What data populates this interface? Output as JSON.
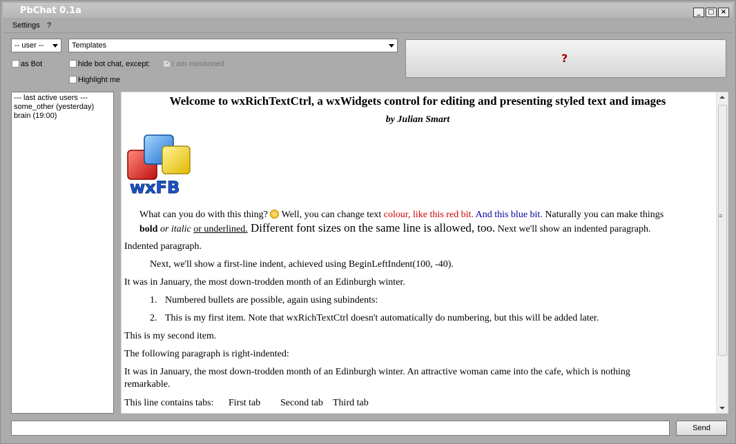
{
  "window": {
    "title": "PbChat 0.1a",
    "minimize": "_",
    "maximize": "□",
    "close": "×"
  },
  "menu": [
    {
      "label": "Settings"
    },
    {
      "label": "?"
    }
  ],
  "toolbar": {
    "user_select": "-- user --",
    "templates_select": "Templates",
    "as_bot": "as Bot",
    "hide_bot_chat": "hide bot chat, except:",
    "i_am_mentioned": "I am mentioned",
    "highlight_me": "Highlight me",
    "help_button": "?"
  },
  "users": {
    "header": "--- last active users ---",
    "items": [
      "some_other (yesterday)",
      "brain (19:00)"
    ]
  },
  "document": {
    "title": "Welcome to wxRichTextCtrl, a wxWidgets control for editing and presenting styled text and images",
    "byline": "by Julian Smart",
    "logo_text": "wxFB",
    "p1_a": "What can you do with this thing? ",
    "p1_b": " Well, you can change text ",
    "p1_red": "colour, like this red bit.",
    "p1_blue": " And this blue bit.",
    "p1_c": " Naturally you can make things",
    "p2_bold": "bold",
    "p2_italic": " or italic",
    "p2_underline": "or underlined.",
    "p2_big": " Different font sizes on the same line is allowed, too.",
    "p2_end": " Next we'll show an indented paragraph.",
    "indented": "Indented paragraph.",
    "first_line_indent": "Next, we'll show a first-line indent, achieved using BeginLeftIndent(100, -40).",
    "january1": "It was in January, the most down-trodden month of an Edinburgh winter.",
    "num1": "1.",
    "bullet1": "Numbered bullets are possible, again using subindents:",
    "num2": "2.",
    "bullet2": "This is my first item. Note that wxRichTextCtrl doesn't automatically do numbering, but this will be added later.",
    "second_item": "This is my second item.",
    "right_indented": "The following paragraph is right-indented:",
    "january2_line1": "It was in January, the most down-trodden month of an Edinburgh winter. An attractive woman came into the cafe, which is nothing",
    "january2_line2": "remarkable.",
    "tabs_label": "This line contains tabs:",
    "tab1": "First tab",
    "tab2": "Second tab",
    "tab3": "Third tab"
  },
  "input": {
    "value": ""
  },
  "send_button": "Send"
}
